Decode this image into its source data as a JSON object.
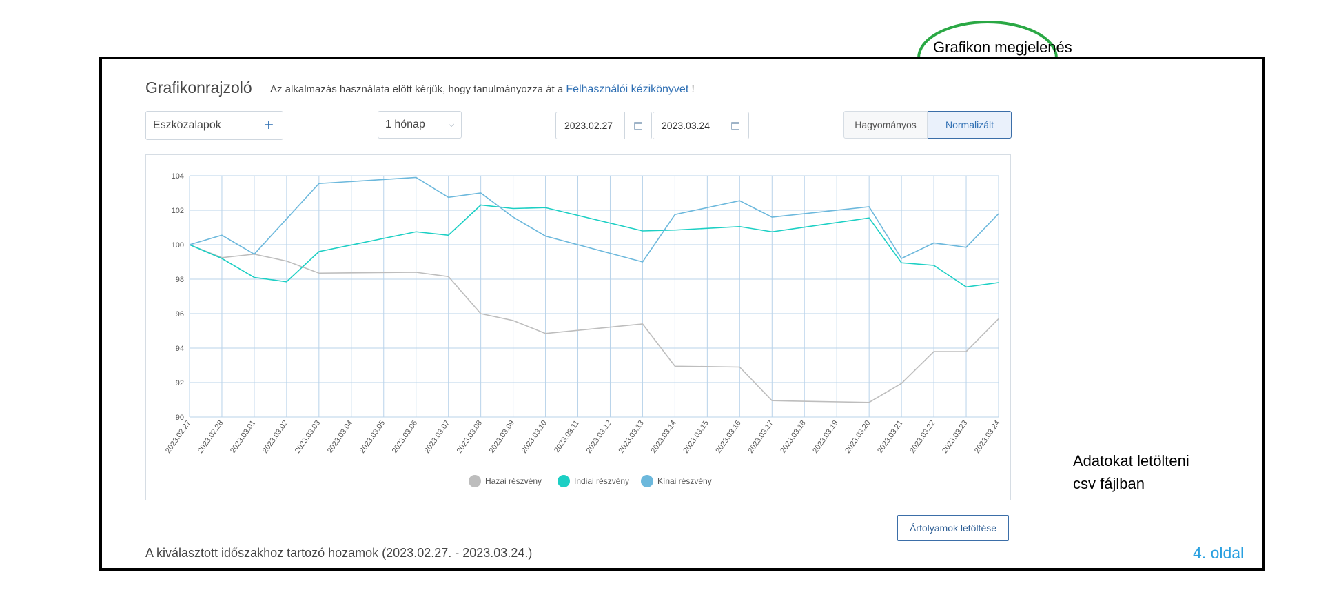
{
  "header": {
    "title": "Grafikonrajzoló",
    "intro_text": "Az alkalmazás használata előtt kérjük, hogy tanulmányozza át a",
    "manual_link": "Felhasználói kézikönyvet",
    "intro_suffix": "!"
  },
  "controls": {
    "asset_picker_label": "Eszközalapok",
    "period_value": "1 hónap",
    "date_start": "2023.02.27",
    "date_end": "2023.03.24",
    "view_classic": "Hagyományos",
    "view_normalized": "Normalizált",
    "view_selected": "Normalizált"
  },
  "chart_data": {
    "type": "line",
    "x": [
      "2023.02.27",
      "2023.02.28",
      "2023.03.01",
      "2023.03.02",
      "2023.03.03",
      "2023.03.04",
      "2023.03.05",
      "2023.03.06",
      "2023.03.07",
      "2023.03.08",
      "2023.03.09",
      "2023.03.10",
      "2023.03.11",
      "2023.03.12",
      "2023.03.13",
      "2023.03.14",
      "2023.03.15",
      "2023.03.16",
      "2023.03.17",
      "2023.03.18",
      "2023.03.19",
      "2023.03.20",
      "2023.03.21",
      "2023.03.22",
      "2023.03.23",
      "2023.03.24"
    ],
    "ylim": [
      90,
      104
    ],
    "yticks": [
      90,
      92,
      94,
      96,
      98,
      100,
      102,
      104
    ],
    "grid": true,
    "legend_position": "bottom-center",
    "series": [
      {
        "name": "Hazai részvény",
        "color": "#bdbdbd",
        "points": [
          [
            "2023.02.27",
            100
          ],
          [
            "2023.02.28",
            99.25
          ],
          [
            "2023.03.01",
            99.45
          ],
          [
            "2023.03.02",
            99.05
          ],
          [
            "2023.03.03",
            98.35
          ],
          [
            "2023.03.06",
            98.4
          ],
          [
            "2023.03.07",
            98.15
          ],
          [
            "2023.03.08",
            96.0
          ],
          [
            "2023.03.09",
            95.6
          ],
          [
            "2023.03.10",
            94.85
          ],
          [
            "2023.03.13",
            95.4
          ],
          [
            "2023.03.14",
            92.95
          ],
          [
            "2023.03.16",
            92.9
          ],
          [
            "2023.03.17",
            90.95
          ],
          [
            "2023.03.20",
            90.85
          ],
          [
            "2023.03.21",
            91.95
          ],
          [
            "2023.03.22",
            93.8
          ],
          [
            "2023.03.23",
            93.8
          ],
          [
            "2023.03.24",
            95.7
          ]
        ]
      },
      {
        "name": "Indiai részvény",
        "color": "#1ccfc4",
        "points": [
          [
            "2023.02.27",
            100
          ],
          [
            "2023.02.28",
            99.2
          ],
          [
            "2023.03.01",
            98.1
          ],
          [
            "2023.03.02",
            97.85
          ],
          [
            "2023.03.03",
            99.6
          ],
          [
            "2023.03.06",
            100.75
          ],
          [
            "2023.03.07",
            100.55
          ],
          [
            "2023.03.08",
            102.3
          ],
          [
            "2023.03.09",
            102.1
          ],
          [
            "2023.03.10",
            102.15
          ],
          [
            "2023.03.13",
            100.8
          ],
          [
            "2023.03.14",
            100.85
          ],
          [
            "2023.03.16",
            101.05
          ],
          [
            "2023.03.17",
            100.75
          ],
          [
            "2023.03.20",
            101.55
          ],
          [
            "2023.03.21",
            98.95
          ],
          [
            "2023.03.22",
            98.8
          ],
          [
            "2023.03.23",
            97.55
          ],
          [
            "2023.03.24",
            97.8
          ]
        ]
      },
      {
        "name": "Kínai részvény",
        "color": "#6cb8dc",
        "points": [
          [
            "2023.02.27",
            100
          ],
          [
            "2023.02.28",
            100.55
          ],
          [
            "2023.03.01",
            99.45
          ],
          [
            "2023.03.03",
            103.55
          ],
          [
            "2023.03.06",
            103.9
          ],
          [
            "2023.03.07",
            102.75
          ],
          [
            "2023.03.08",
            103.0
          ],
          [
            "2023.03.09",
            101.6
          ],
          [
            "2023.03.10",
            100.5
          ],
          [
            "2023.03.13",
            99.0
          ],
          [
            "2023.03.14",
            101.75
          ],
          [
            "2023.03.16",
            102.55
          ],
          [
            "2023.03.17",
            101.6
          ],
          [
            "2023.03.20",
            102.2
          ],
          [
            "2023.03.21",
            99.2
          ],
          [
            "2023.03.22",
            100.1
          ],
          [
            "2023.03.23",
            99.85
          ],
          [
            "2023.03.24",
            101.8
          ]
        ]
      }
    ]
  },
  "actions": {
    "download_label": "Árfolyamok letöltése"
  },
  "footer": {
    "period_returns": "A kiválasztott időszakhoz tartozó hozamok (2023.02.27. - 2023.03.24.)",
    "page_number": "4. oldal"
  },
  "annotations": {
    "view_callout": "Grafikon megjelenés",
    "download_callout_line1": "Adatokat letölteni",
    "download_callout_line2": "csv fájlban",
    "callout_color": "#2aa844"
  }
}
